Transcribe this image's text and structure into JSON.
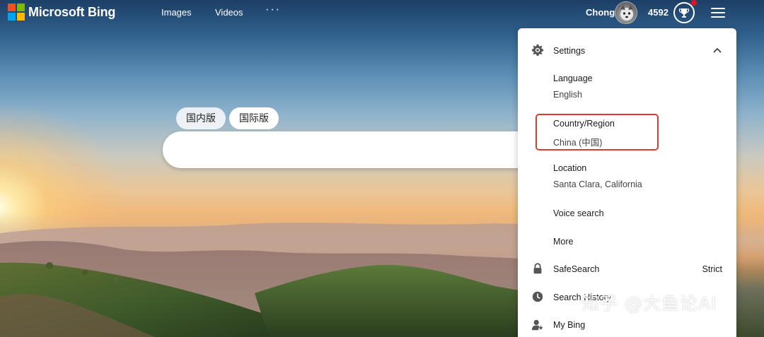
{
  "header": {
    "brand": "Microsoft Bing",
    "nav": [
      "Images",
      "Videos"
    ],
    "more_dots": "···",
    "user_name": "Chong",
    "points": "4592",
    "icons": {
      "logo": "microsoft-logo-icon",
      "reward": "trophy-icon",
      "menu": "hamburger-icon"
    },
    "logo_colors": [
      "#f25022",
      "#7fba00",
      "#00a4ef",
      "#ffb900"
    ]
  },
  "search": {
    "tabs": [
      "国内版",
      "国际版"
    ],
    "selected_tab": "国际版"
  },
  "settings": {
    "header": "Settings",
    "items": [
      {
        "title": "Language",
        "value": "English"
      },
      {
        "title": "Country/Region",
        "value": "China (中国)"
      },
      {
        "title": "Location",
        "value": "Santa Clara, California"
      },
      {
        "title": "Voice search"
      },
      {
        "title": "More"
      }
    ],
    "safesearch": {
      "label": "SafeSearch",
      "value": "Strict"
    },
    "search_history": "Search History",
    "my_bing": "My Bing",
    "highlight_color": "#e03a2f"
  },
  "watermark": "知乎 @大鱼论AI"
}
